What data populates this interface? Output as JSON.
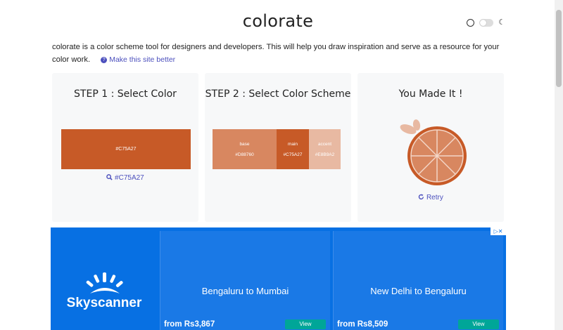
{
  "header": {
    "title": "colorate"
  },
  "intro": {
    "text": "colorate is a color scheme tool for designers and developers. This will help you draw inspiration and serve as a resource for your color work.",
    "help_link": "Make this site better"
  },
  "step1": {
    "title": "STEP 1 : Select Color",
    "color_hex": "#C75A27",
    "search_label": "#C75A27"
  },
  "step2": {
    "title": "STEP 2 : Select Color Scheme",
    "swatches": [
      {
        "label": "base",
        "hex": "#D88760"
      },
      {
        "label": "main",
        "hex": "#C75A27"
      },
      {
        "label": "accent",
        "hex": "#E8B9A2"
      }
    ]
  },
  "step3": {
    "title": "You Made It !",
    "retry_label": "Retry"
  },
  "ad": {
    "brand": "Skyscanner",
    "cards": [
      {
        "route": "Bengaluru to Mumbai",
        "price": "from Rs3,867",
        "cta": "View"
      },
      {
        "route": "New Delhi to Bengaluru",
        "price": "from Rs8,509",
        "cta": "View"
      }
    ]
  },
  "colors": {
    "accent": "#C75A27",
    "link": "#4b4fbd",
    "ad_background": "#0770e3"
  },
  "icons": {
    "theme_light": "sun-icon",
    "theme_dark": "moon-icon",
    "search": "search-icon",
    "retry": "refresh-icon",
    "help": "question-icon"
  }
}
